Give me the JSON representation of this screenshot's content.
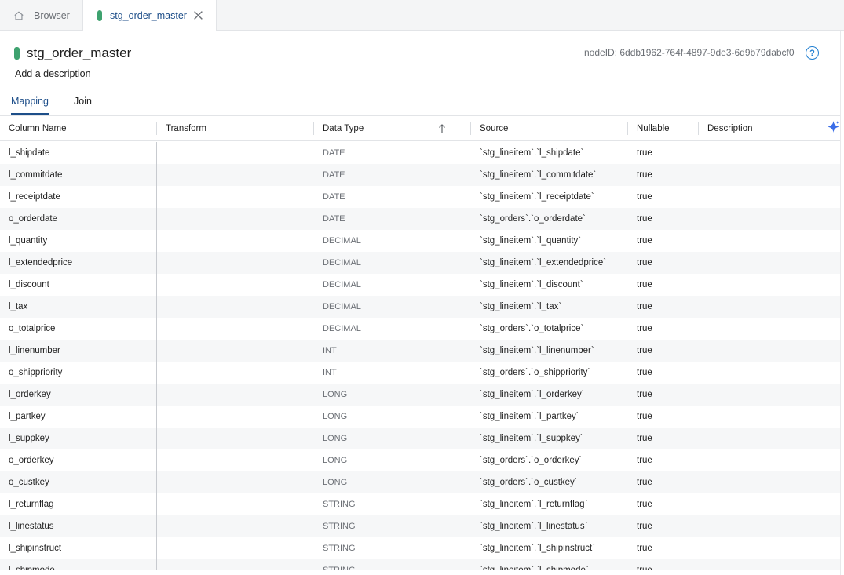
{
  "tabs": {
    "browser_label": "Browser",
    "active_label": "stg_order_master"
  },
  "header": {
    "title": "stg_order_master",
    "node_id": "nodeID: 6ddb1962-764f-4897-9de3-6d9b79dabcf0",
    "help_glyph": "?",
    "description_placeholder": "Add a description"
  },
  "subtabs": {
    "mapping": "Mapping",
    "join": "Join"
  },
  "columns": {
    "name": "Column Name",
    "transform": "Transform",
    "data_type": "Data Type",
    "source": "Source",
    "nullable": "Nullable",
    "description": "Description"
  },
  "colors": {
    "accent": "#1d4e89",
    "node_pill": "#3ea26f",
    "help": "#1f7ed1"
  },
  "rows": [
    {
      "name": "l_shipdate",
      "type": "DATE",
      "source": "`stg_lineitem`.`l_shipdate`",
      "nullable": "true"
    },
    {
      "name": "l_commitdate",
      "type": "DATE",
      "source": "`stg_lineitem`.`l_commitdate`",
      "nullable": "true"
    },
    {
      "name": "l_receiptdate",
      "type": "DATE",
      "source": "`stg_lineitem`.`l_receiptdate`",
      "nullable": "true"
    },
    {
      "name": "o_orderdate",
      "type": "DATE",
      "source": "`stg_orders`.`o_orderdate`",
      "nullable": "true"
    },
    {
      "name": "l_quantity",
      "type": "DECIMAL",
      "source": "`stg_lineitem`.`l_quantity`",
      "nullable": "true"
    },
    {
      "name": "l_extendedprice",
      "type": "DECIMAL",
      "source": "`stg_lineitem`.`l_extendedprice`",
      "nullable": "true"
    },
    {
      "name": "l_discount",
      "type": "DECIMAL",
      "source": "`stg_lineitem`.`l_discount`",
      "nullable": "true"
    },
    {
      "name": "l_tax",
      "type": "DECIMAL",
      "source": "`stg_lineitem`.`l_tax`",
      "nullable": "true"
    },
    {
      "name": "o_totalprice",
      "type": "DECIMAL",
      "source": "`stg_orders`.`o_totalprice`",
      "nullable": "true"
    },
    {
      "name": "l_linenumber",
      "type": "INT",
      "source": "`stg_lineitem`.`l_linenumber`",
      "nullable": "true"
    },
    {
      "name": "o_shippriority",
      "type": "INT",
      "source": "`stg_orders`.`o_shippriority`",
      "nullable": "true"
    },
    {
      "name": "l_orderkey",
      "type": "LONG",
      "source": "`stg_lineitem`.`l_orderkey`",
      "nullable": "true"
    },
    {
      "name": "l_partkey",
      "type": "LONG",
      "source": "`stg_lineitem`.`l_partkey`",
      "nullable": "true"
    },
    {
      "name": "l_suppkey",
      "type": "LONG",
      "source": "`stg_lineitem`.`l_suppkey`",
      "nullable": "true"
    },
    {
      "name": "o_orderkey",
      "type": "LONG",
      "source": "`stg_orders`.`o_orderkey`",
      "nullable": "true"
    },
    {
      "name": "o_custkey",
      "type": "LONG",
      "source": "`stg_orders`.`o_custkey`",
      "nullable": "true"
    },
    {
      "name": "l_returnflag",
      "type": "STRING",
      "source": "`stg_lineitem`.`l_returnflag`",
      "nullable": "true"
    },
    {
      "name": "l_linestatus",
      "type": "STRING",
      "source": "`stg_lineitem`.`l_linestatus`",
      "nullable": "true"
    },
    {
      "name": "l_shipinstruct",
      "type": "STRING",
      "source": "`stg_lineitem`.`l_shipinstruct`",
      "nullable": "true"
    },
    {
      "name": "l_shipmode",
      "type": "STRING",
      "source": "`stg_lineitem`.`l_shipmode`",
      "nullable": "true"
    }
  ]
}
